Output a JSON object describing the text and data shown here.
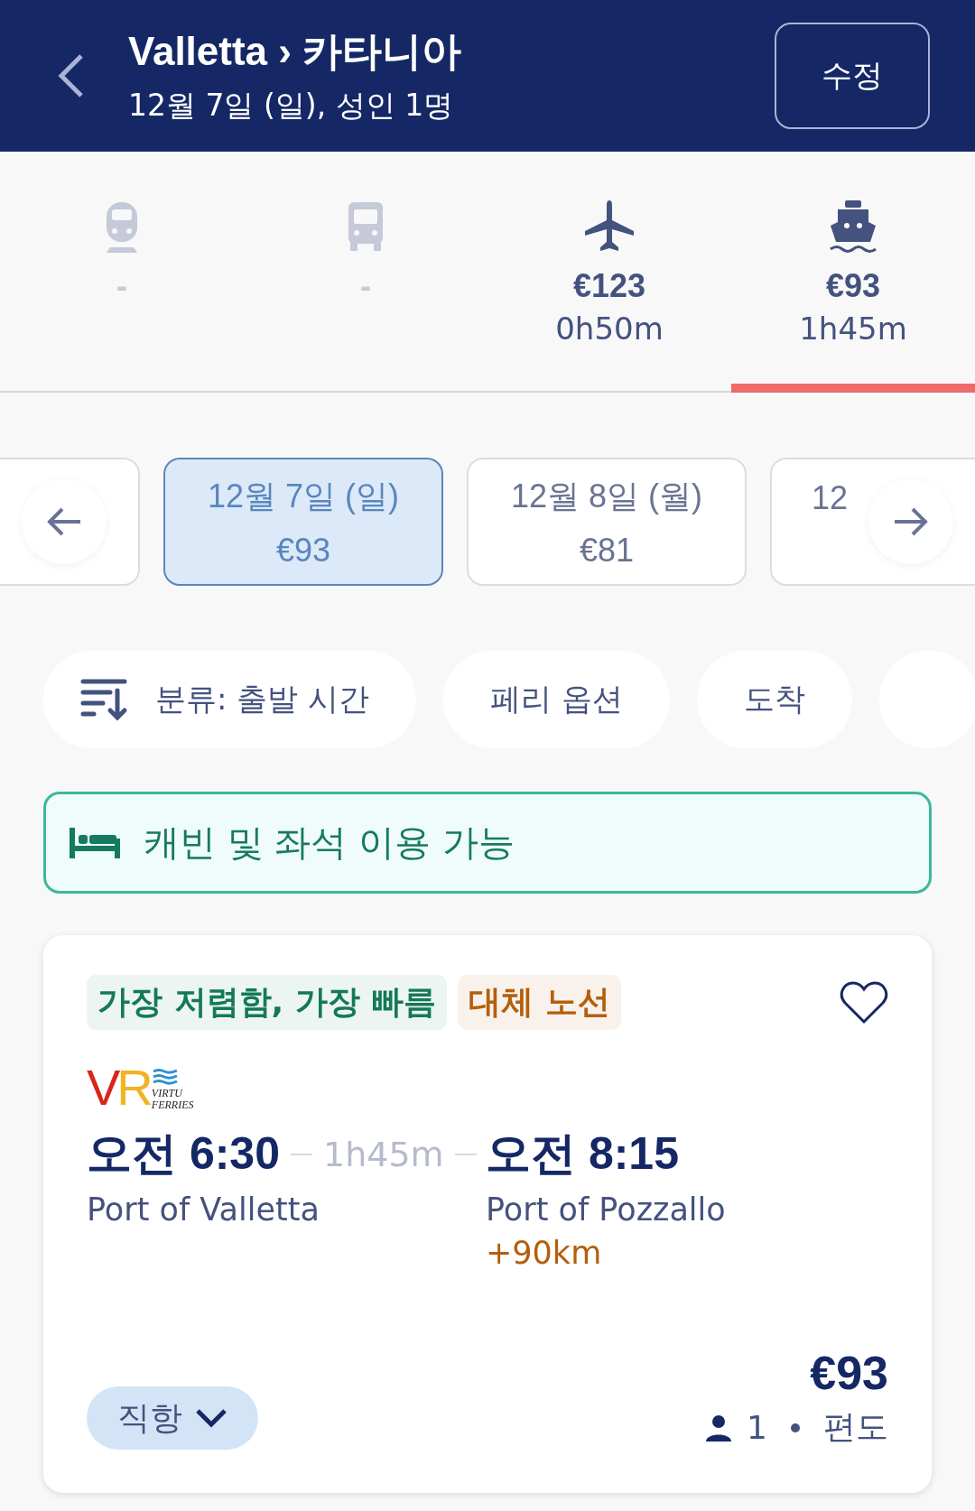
{
  "header": {
    "title": "Valletta › 카타니아",
    "subtitle": "12월 7일 (일), 성인 1명",
    "edit_button": "수정"
  },
  "modes": [
    {
      "kind": "train",
      "price": "-",
      "available": false,
      "selected": false
    },
    {
      "kind": "bus",
      "price": "-",
      "available": false,
      "selected": false
    },
    {
      "kind": "plane",
      "price": "€123",
      "duration": "0h50m",
      "available": true,
      "selected": false
    },
    {
      "kind": "ferry",
      "price": "€93",
      "duration": "1h45m",
      "available": true,
      "selected": true
    }
  ],
  "dates": [
    {
      "kind": "cut",
      "selected": false
    },
    {
      "kind": "full",
      "date": "12월 7일 (일)",
      "price": "€93",
      "selected": true
    },
    {
      "kind": "full",
      "date": "12월 8일 (월)",
      "price": "€81",
      "selected": false
    },
    {
      "kind": "cut",
      "date": "12",
      "selected": false
    }
  ],
  "filters": [
    {
      "kind": "sort",
      "label": "분류: 출발 시간"
    },
    {
      "kind": "plain",
      "label": "페리 옵션"
    },
    {
      "kind": "plain",
      "label": "도착"
    },
    {
      "kind": "cut"
    }
  ],
  "banner": {
    "text": "캐빈 및 좌석 이용 가능"
  },
  "result": {
    "badges": [
      {
        "text": "가장 저렴함, 가장 빠름",
        "color": "#137a55"
      },
      {
        "text": "대체 노선",
        "color": "#b45f0c"
      }
    ],
    "favorite": false,
    "operator_logo": {
      "letters": [
        "V",
        "R"
      ],
      "name_lines": [
        "VIRTU",
        "FERRIES"
      ]
    },
    "depart_time": "오전 6:30",
    "duration": "1h45m",
    "arrive_time": "오전 8:15",
    "depart_port": "Port of Valletta",
    "arrive_port": "Port of Pozzallo",
    "arrive_extra": "+90km",
    "stops_button": "직항",
    "price": "€93",
    "passengers": "1",
    "trip_type": "편도"
  }
}
